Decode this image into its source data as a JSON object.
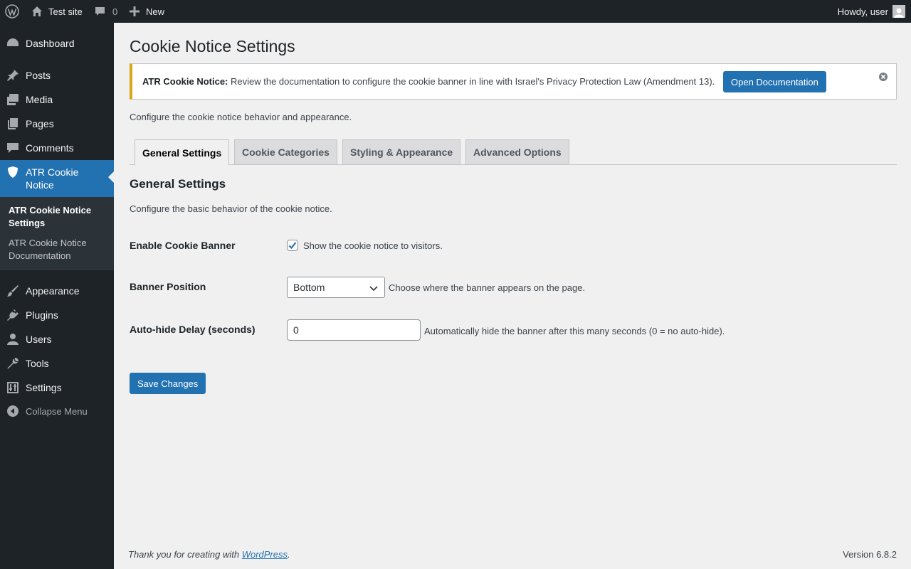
{
  "adminbar": {
    "site_name": "Test site",
    "comments_count": "0",
    "new_label": "New",
    "howdy": "Howdy, user"
  },
  "sidebar": {
    "items": [
      {
        "label": "Dashboard",
        "icon": "dashboard-icon"
      },
      {
        "label": "Posts",
        "icon": "pin-icon"
      },
      {
        "label": "Media",
        "icon": "media-icon"
      },
      {
        "label": "Pages",
        "icon": "pages-icon"
      },
      {
        "label": "Comments",
        "icon": "comment-icon"
      },
      {
        "label": "ATR Cookie Notice",
        "icon": "shield-icon",
        "active": true
      },
      {
        "label": "Appearance",
        "icon": "brush-icon"
      },
      {
        "label": "Plugins",
        "icon": "plug-icon"
      },
      {
        "label": "Users",
        "icon": "user-icon"
      },
      {
        "label": "Tools",
        "icon": "wrench-icon"
      },
      {
        "label": "Settings",
        "icon": "settings-icon"
      }
    ],
    "submenu": [
      {
        "label": "ATR Cookie Notice Settings",
        "current": true
      },
      {
        "label": "ATR Cookie Notice Documentation",
        "current": false
      }
    ],
    "collapse_label": "Collapse Menu"
  },
  "page": {
    "title": "Cookie Notice Settings",
    "notice": {
      "strong": "ATR Cookie Notice:",
      "text": "Review the documentation to configure the cookie banner in line with Israel's Privacy Protection Law (Amendment 13).",
      "button": "Open Documentation"
    },
    "intro": "Configure the cookie notice behavior and appearance.",
    "tabs": [
      {
        "label": "General Settings",
        "active": true
      },
      {
        "label": "Cookie Categories",
        "active": false
      },
      {
        "label": "Styling & Appearance",
        "active": false
      },
      {
        "label": "Advanced Options",
        "active": false
      }
    ],
    "section_title": "General Settings",
    "section_desc": "Configure the basic behavior of the cookie notice.",
    "fields": {
      "enable_banner": {
        "label": "Enable Cookie Banner",
        "checked": true,
        "checkbox_label": "Show the cookie notice to visitors."
      },
      "banner_position": {
        "label": "Banner Position",
        "value": "Bottom",
        "description": "Choose where the banner appears on the page."
      },
      "auto_hide": {
        "label": "Auto-hide Delay (seconds)",
        "value": "0",
        "description": "Automatically hide the banner after this many seconds (0 = no auto-hide)."
      }
    },
    "save_button": "Save Changes"
  },
  "footer": {
    "thanks_prefix": "Thank you for creating with ",
    "thanks_link": "WordPress",
    "thanks_suffix": ".",
    "version": "Version 6.8.2"
  },
  "colors": {
    "accent": "#2271b1",
    "admin_dark": "#1d2327",
    "notice_warning": "#dba617"
  }
}
